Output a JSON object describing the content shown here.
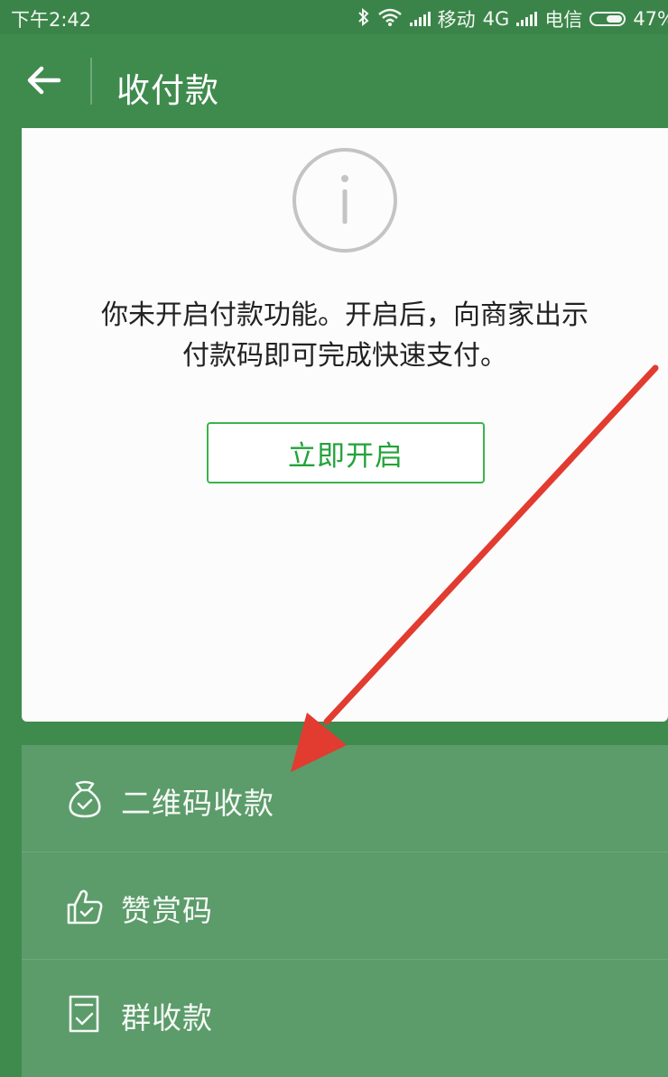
{
  "status_bar": {
    "time": "下午2:42",
    "carrier1": "移动",
    "network": "4G",
    "carrier2": "电信",
    "battery": "47%",
    "battery_level": 0.47
  },
  "header": {
    "title": "收付款",
    "back_icon": "arrow-left-icon"
  },
  "notice": {
    "icon": "info-circle-icon",
    "line1": "你未开启付款功能。开启后，向商家出示",
    "line2": "付款码即可完成快速支付。",
    "button_label": "立即开启",
    "accent_color": "#39b54a"
  },
  "menu": {
    "items": [
      {
        "label": "二维码收款",
        "icon": "money-bag-icon"
      },
      {
        "label": "赞赏码",
        "icon": "thumbs-up-icon"
      },
      {
        "label": "群收款",
        "icon": "document-check-icon"
      }
    ]
  },
  "colors": {
    "primary": "#3f8b4e",
    "menu_bg": "#5c9b6a",
    "annotation_arrow": "#e23b30"
  }
}
